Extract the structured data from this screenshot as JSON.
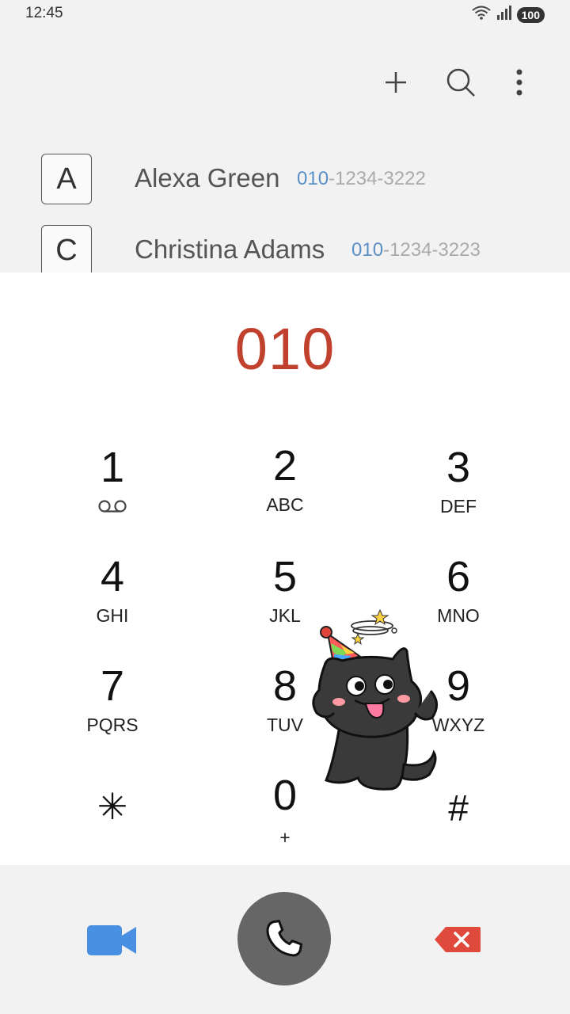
{
  "status_bar": {
    "time": "12:45",
    "battery": "100",
    "icons": [
      "wifi-icon",
      "signal-icon",
      "battery-icon"
    ]
  },
  "action_bar": {
    "icons": [
      "add-icon",
      "search-icon",
      "more-icon"
    ]
  },
  "contacts": [
    {
      "initial": "A",
      "name": "Alexa Green",
      "number_match": "010",
      "number_rest": "-1234-3222"
    },
    {
      "initial": "C",
      "name": "Christina Adams",
      "number_match": "010",
      "number_rest": "-1234-3223"
    }
  ],
  "dialer": {
    "number": "010",
    "keys": [
      {
        "digit": "1",
        "sub": "",
        "sub_icon": "voicemail-icon"
      },
      {
        "digit": "2",
        "sub": "ABC"
      },
      {
        "digit": "3",
        "sub": "DEF"
      },
      {
        "digit": "4",
        "sub": "GHI"
      },
      {
        "digit": "5",
        "sub": "JKL"
      },
      {
        "digit": "6",
        "sub": "MNO"
      },
      {
        "digit": "7",
        "sub": "PQRS"
      },
      {
        "digit": "8",
        "sub": "TUV"
      },
      {
        "digit": "9",
        "sub": "WXYZ"
      },
      {
        "digit": "✳",
        "sub": ""
      },
      {
        "digit": "0",
        "sub": "+"
      },
      {
        "digit": "#",
        "sub": ""
      }
    ]
  },
  "sticker": {
    "icon": "party-cat-sticker"
  },
  "bottom_bar": {
    "icons": [
      "video-call-icon",
      "phone-icon",
      "backspace-icon"
    ]
  },
  "colors": {
    "dial_number": "#c0412e",
    "number_highlight": "#5a8fc8",
    "video_icon": "#4a90e2",
    "backspace_icon": "#e04a3c",
    "call_button": "#666666"
  }
}
